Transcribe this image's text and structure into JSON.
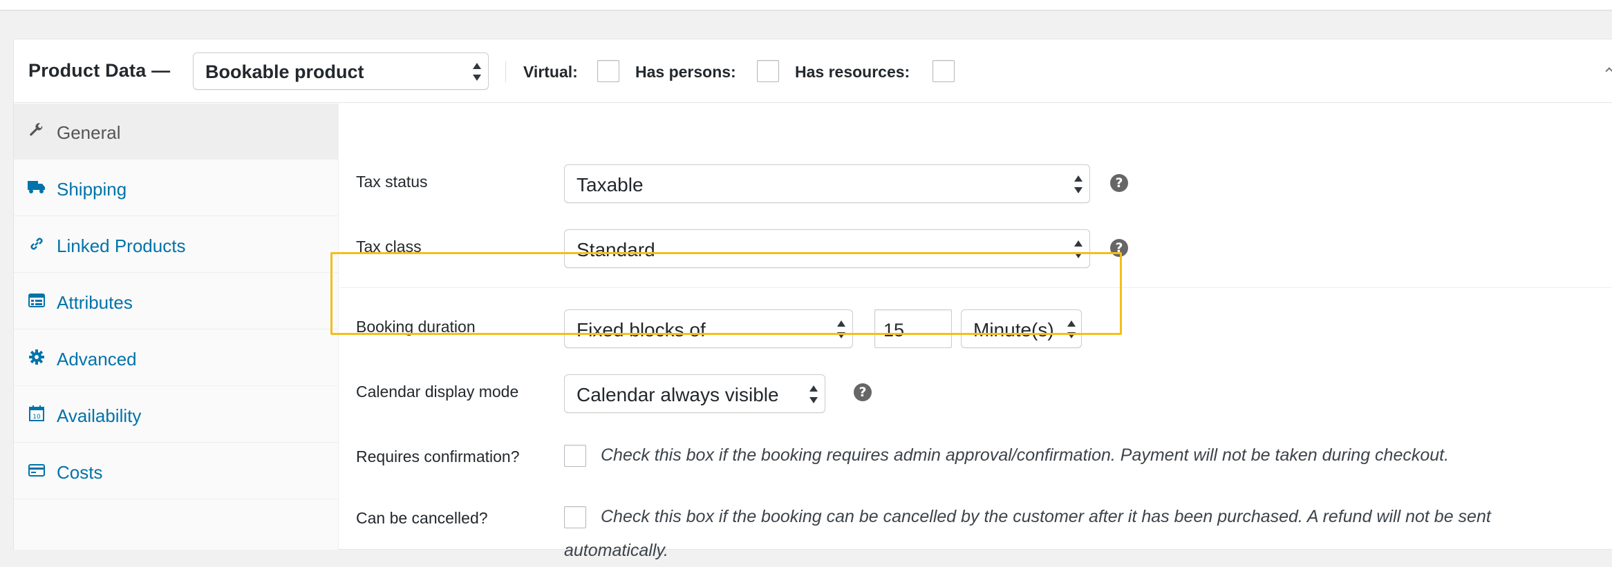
{
  "header": {
    "title": "Product Data —",
    "product_type": "Bookable product",
    "virtual_label": "Virtual:",
    "has_persons_label": "Has persons:",
    "has_resources_label": "Has resources:"
  },
  "sidebar": {
    "items": [
      {
        "label": "General",
        "icon": "wrench-icon",
        "active": true
      },
      {
        "label": "Shipping",
        "icon": "truck-icon",
        "active": false
      },
      {
        "label": "Linked Products",
        "icon": "link-icon",
        "active": false
      },
      {
        "label": "Attributes",
        "icon": "list-icon",
        "active": false
      },
      {
        "label": "Advanced",
        "icon": "gear-icon",
        "active": false
      },
      {
        "label": "Availability",
        "icon": "calendar-icon",
        "active": false
      },
      {
        "label": "Costs",
        "icon": "card-icon",
        "active": false
      }
    ]
  },
  "fields": {
    "tax_status": {
      "label": "Tax status",
      "value": "Taxable"
    },
    "tax_class": {
      "label": "Tax class",
      "value": "Standard"
    },
    "booking_duration": {
      "label": "Booking duration",
      "type_value": "Fixed blocks of",
      "amount": "15",
      "unit": "Minute(s)"
    },
    "calendar_display_mode": {
      "label": "Calendar display mode",
      "value": "Calendar always visible"
    },
    "requires_confirmation": {
      "label": "Requires confirmation?",
      "description": "Check this box if the booking requires admin approval/confirmation. Payment will not be taken during checkout."
    },
    "can_be_cancelled": {
      "label": "Can be cancelled?",
      "description_line1": "Check this box if the booking can be cancelled by the customer after it has been purchased. A refund will not be sent",
      "description_line2": "automatically."
    }
  },
  "help_symbol": "?",
  "colors": {
    "link": "#0073aa",
    "highlight": "#f4be1a"
  }
}
